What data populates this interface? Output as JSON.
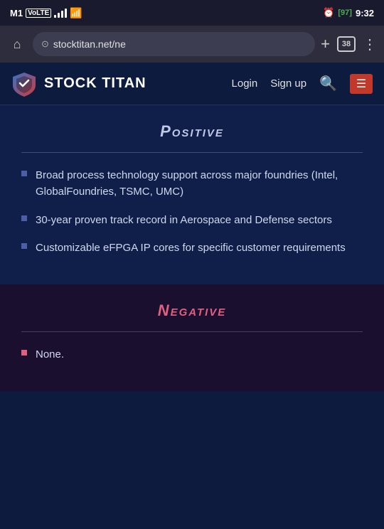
{
  "status_bar": {
    "carrier": "M1",
    "carrier_type": "VoLTE",
    "time": "9:32",
    "battery": "97",
    "alarm": "⏰"
  },
  "browser": {
    "url": "stocktitan.net/ne",
    "tabs_count": "38",
    "home_icon": "⌂",
    "plus_icon": "+",
    "more_icon": "⋮"
  },
  "navbar": {
    "logo_text": "STOCK TITAN",
    "login_label": "Login",
    "signup_label": "Sign up",
    "search_icon": "🔍",
    "menu_icon": "☰"
  },
  "sections": {
    "positive": {
      "title": "Positive",
      "bullets": [
        "Broad process technology support across major foundries (Intel, GlobalFoundries, TSMC, UMC)",
        "30-year proven track record in Aerospace and Defense sectors",
        "Customizable eFPGA IP cores for specific customer requirements"
      ]
    },
    "negative": {
      "title": "Negative",
      "bullets": [
        "None."
      ]
    }
  }
}
